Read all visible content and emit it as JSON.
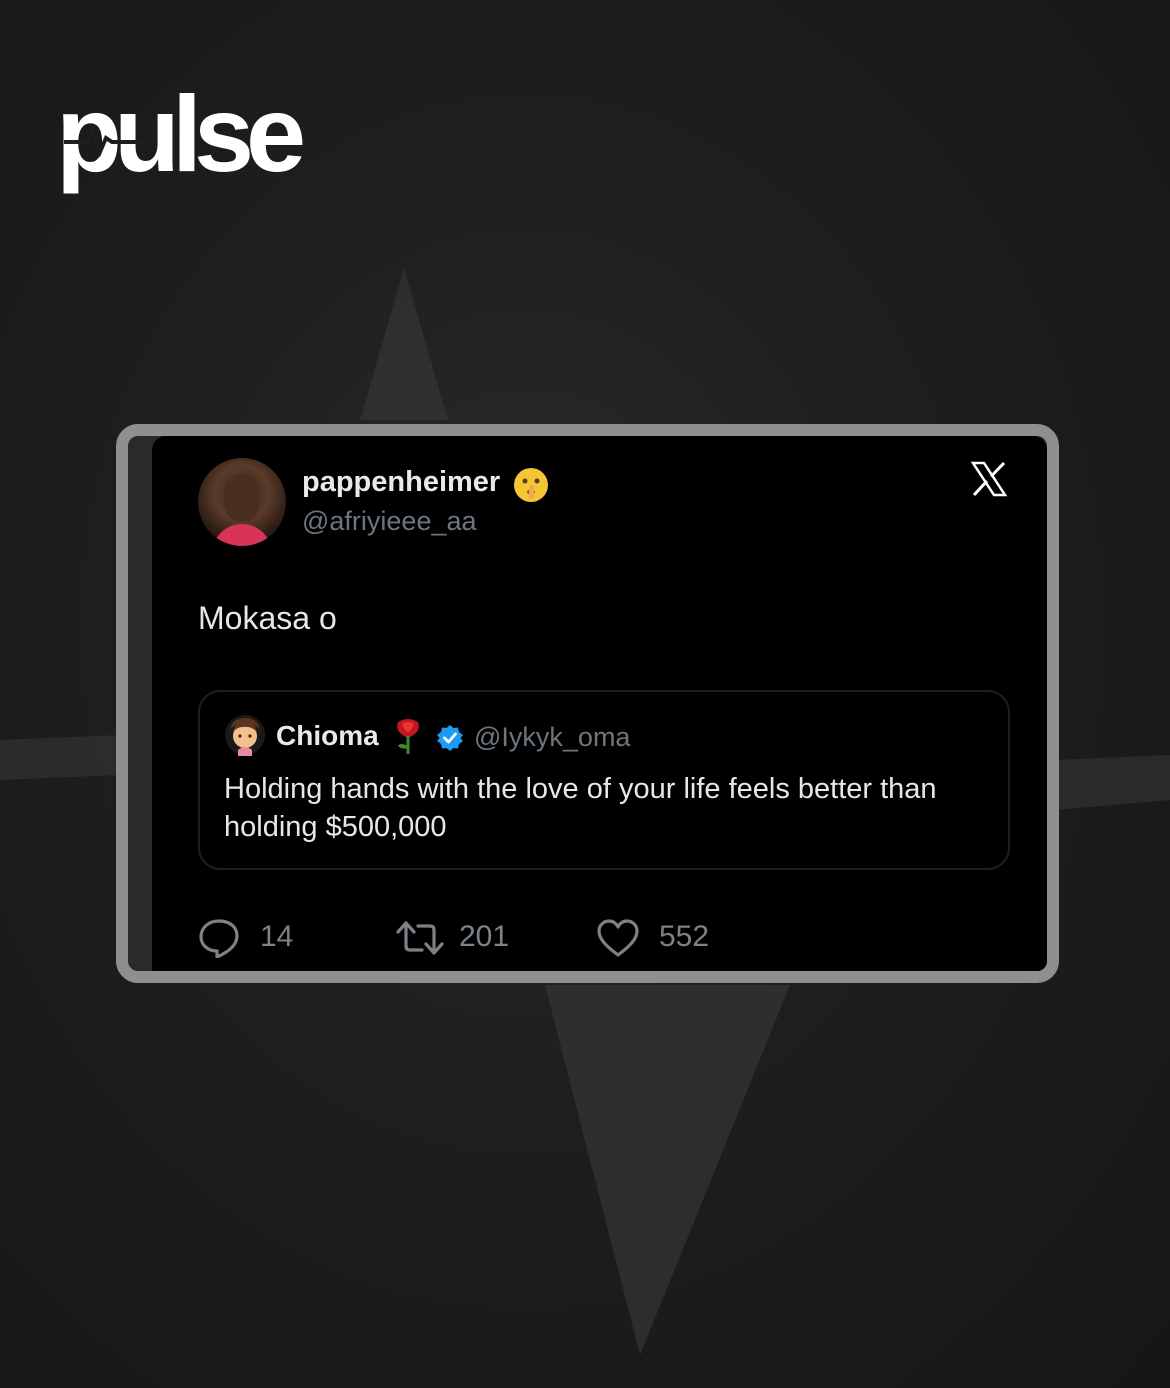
{
  "brand": {
    "logo_text": "pulse"
  },
  "tweet": {
    "display_name": "pappenheimer",
    "name_emoji": "shushing-face-emoji",
    "handle": "@afriyieee_aa",
    "text": "Mokasa o",
    "platform_icon": "x-logo-icon",
    "quoted": {
      "display_name": "Chioma",
      "name_emoji": "rose-emoji",
      "verified": true,
      "handle": "@Iykyk_oma",
      "text": "Holding hands with the love of your life feels better than holding $500,000"
    },
    "stats": {
      "replies": "14",
      "reposts": "201",
      "likes": "552"
    }
  },
  "colors": {
    "background": "#1e1e1e",
    "card": "#000000",
    "frame": "#8f8f8f",
    "verified_blue": "#1d9bf0",
    "muted_text": "#6e767d"
  }
}
